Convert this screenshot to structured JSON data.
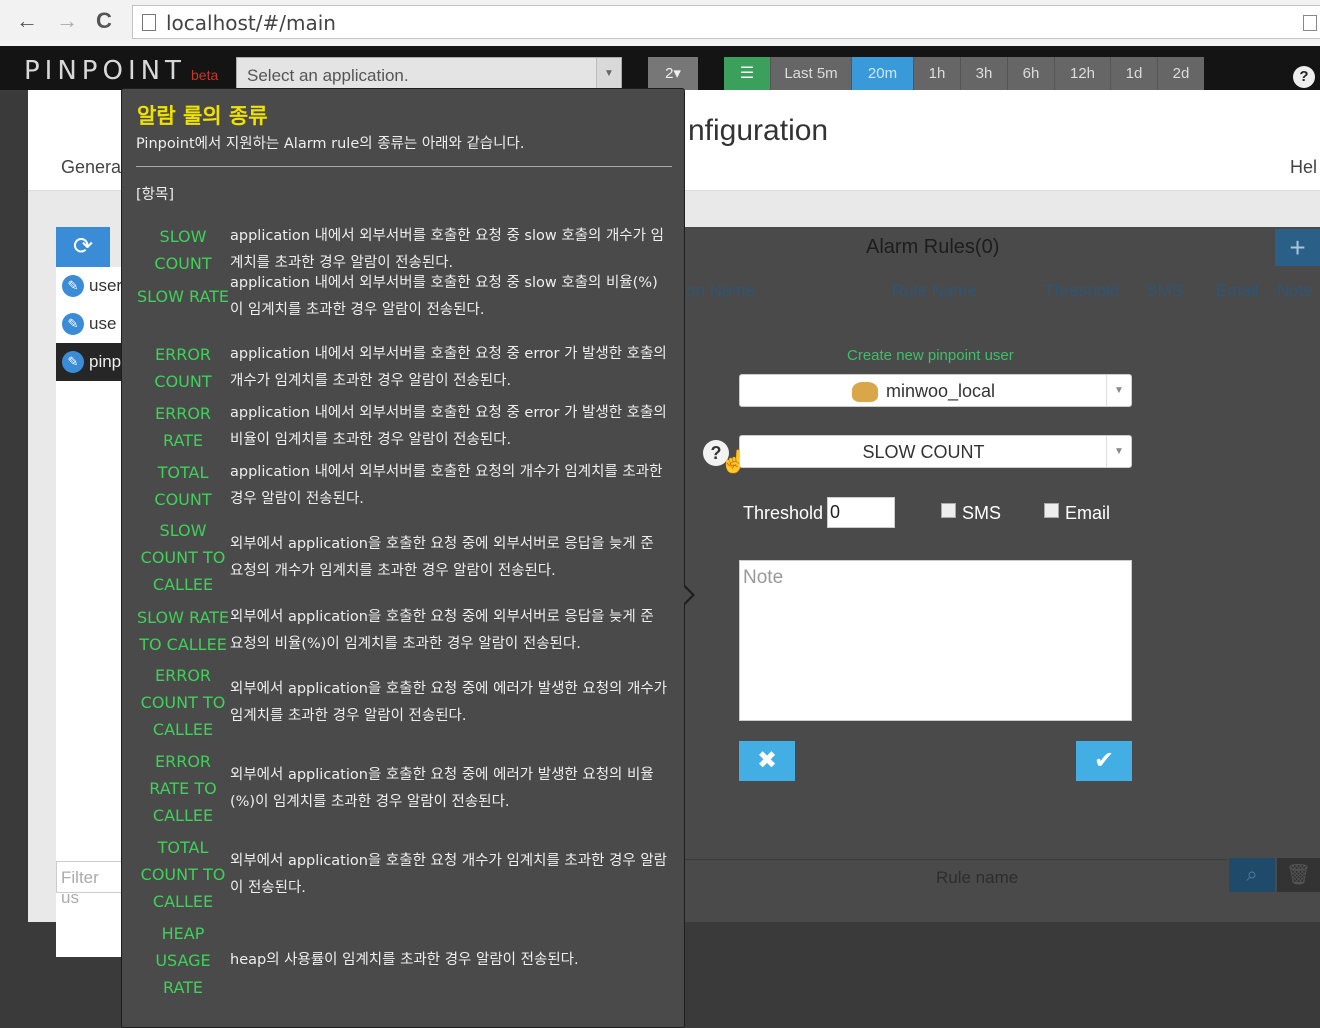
{
  "browser": {
    "back": "←",
    "forward": "→",
    "reload": "C",
    "url": "localhost/#/main"
  },
  "topnav": {
    "logo": "PINPOINT",
    "beta": "beta",
    "app_select_placeholder": "Select an application.",
    "count_button": "2▾",
    "periods": [
      "Last 5m",
      "20m",
      "1h",
      "3h",
      "6h",
      "12h",
      "1d",
      "2d"
    ],
    "active_period": "20m",
    "help": "?"
  },
  "panel": {
    "title_visible": "nfiguration",
    "tab_general": "Genera",
    "tab_help": "Hel",
    "users": [
      {
        "name": "user",
        "selected": false
      },
      {
        "name": "use",
        "selected": false
      },
      {
        "name": "pinp",
        "selected": true
      }
    ],
    "filter_placeholder": "Filter us"
  },
  "rules": {
    "title": "Alarm Rules(0)",
    "add_button": "+",
    "columns": [
      "on Name",
      "Rule Name",
      "Threshold",
      "SMS",
      "Email",
      "Note"
    ],
    "create_link": "Create new pinpoint user",
    "user_select": "minwoo_local",
    "rule_select": "SLOW COUNT",
    "threshold_label": "Threshold",
    "threshold_value": "0",
    "sms_label": "SMS",
    "email_label": "Email",
    "note_placeholder": "Note",
    "cancel_icon": "✖",
    "ok_icon": "✔",
    "rule_filter_placeholder": "Rule name"
  },
  "tooltip": {
    "title": "알람 룰의 종류",
    "subtitle": "Pinpoint에서 지원하는 Alarm rule의 종류는 아래와 같습니다.",
    "section": "[항목]",
    "rules": [
      {
        "name": "SLOW\nCOUNT",
        "desc": "application 내에서 외부서버를 호출한 요청 중 slow 호출의 개수가 임계치를 초과한 경우 알람이 전송된다."
      },
      {
        "name": "SLOW RATE",
        "desc": "application 내에서 외부서버를 호출한 요청 중 slow 호출의 비율(%)이 임계치를 초과한 경우 알람이 전송된다."
      },
      {
        "name": "ERROR\nCOUNT",
        "desc": "application 내에서 외부서버를 호출한 요청 중 error 가 발생한 호출의 개수가 임계치를 초과한 경우 알람이 전송된다."
      },
      {
        "name": "ERROR\nRATE",
        "desc": "application 내에서 외부서버를 호출한 요청 중 error 가 발생한 호출의 비율이 임계치를 초과한 경우 알람이 전송된다."
      },
      {
        "name": "TOTAL\nCOUNT",
        "desc": "application 내에서 외부서버를 호출한 요청의 개수가 임계치를 초과한 경우 알람이 전송된다."
      },
      {
        "name": "SLOW\nCOUNT TO\nCALLEE",
        "desc": "외부에서 application을 호출한 요청 중에 외부서버로 응답을 늦게 준 요청의 개수가 임계치를 초과한 경우 알람이 전송된다."
      },
      {
        "name": "SLOW RATE\nTO CALLEE",
        "desc": "외부에서 application을 호출한 요청 중에 외부서버로 응답을 늦게 준 요청의 비율(%)이 임계치를 초과한 경우 알람이 전송된다."
      },
      {
        "name": "ERROR\nCOUNT TO\nCALLEE",
        "desc": "외부에서 application을 호출한 요청 중에 에러가 발생한 요청의 개수가 임계치를 초과한 경우 알람이 전송된다."
      },
      {
        "name": "ERROR\nRATE TO\nCALLEE",
        "desc": "외부에서 application을 호출한 요청 중에 에러가 발생한 요청의 비율(%)이 임계치를 초과한 경우 알람이 전송된다."
      },
      {
        "name": "TOTAL\nCOUNT TO\nCALLEE",
        "desc": "외부에서 application을 호출한 요청 개수가 임계치를 초과한 경우 알람이 전송된다."
      },
      {
        "name": "HEAP\nUSAGE\nRATE",
        "desc": "heap의 사용률이 임계치를 초과한 경우 알람이 전송된다."
      }
    ]
  },
  "colors": {
    "accent_blue": "#3a8cd6",
    "rule_name_green": "#3fd15a",
    "tooltip_title_yellow": "#f0e200",
    "button_cyan": "#43aee3"
  }
}
